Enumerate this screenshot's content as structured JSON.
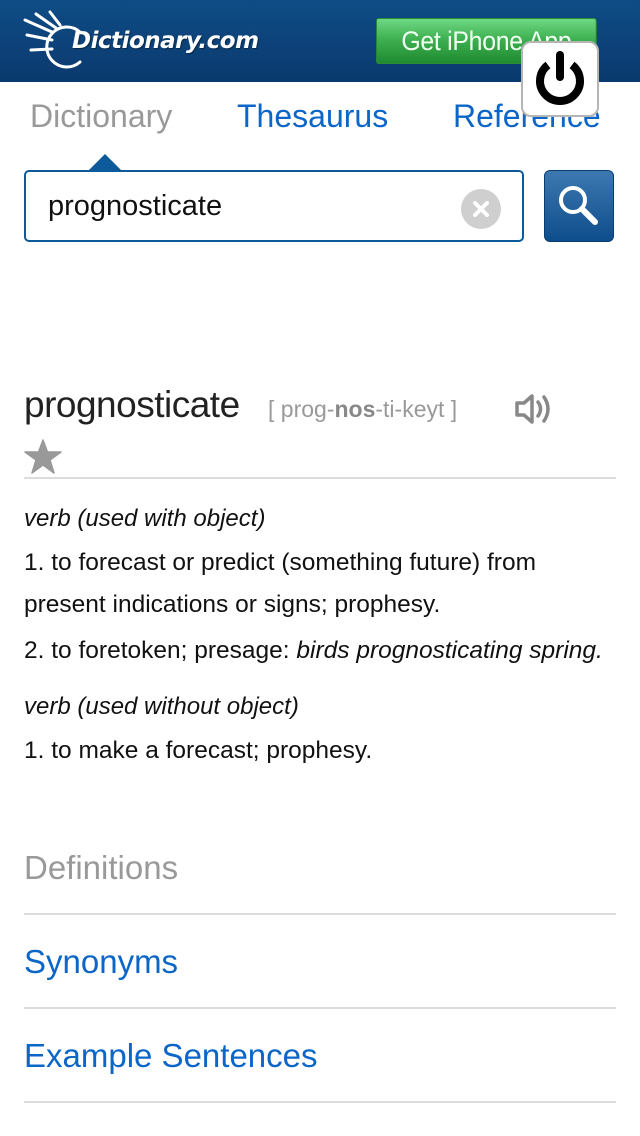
{
  "header": {
    "logo_text": "Dictionary.com",
    "get_app_label": "Get iPhone App",
    "brand_color": "#0f4c86",
    "app_button_color": "#3fb152"
  },
  "overlay": {
    "icon": "power-icon"
  },
  "tabs": [
    {
      "label": "Dictionary",
      "active": true
    },
    {
      "label": "Thesaurus",
      "active": false
    },
    {
      "label": "Reference",
      "active": false
    }
  ],
  "search": {
    "value": "prognosticate",
    "placeholder": "",
    "clear_icon": "clear-icon",
    "button_icon": "search-icon"
  },
  "entry": {
    "headword": "prognosticate",
    "pronunciation": {
      "open": "[ prog-",
      "stressed": "nos",
      "close": "-ti-keyt ]"
    },
    "audio_icon": "speaker-icon",
    "favorite_icon": "star-icon",
    "senses": [
      {
        "pos": "verb (used with object)",
        "definitions": [
          {
            "text": "1. to forecast or predict (something future) from present indications or signs; prophesy.",
            "example": ""
          },
          {
            "text": "2. to foretoken; presage: ",
            "example": "birds prognosticating spring."
          }
        ]
      },
      {
        "pos": "verb (used without object)",
        "definitions": [
          {
            "text": "1. to make a forecast; prophesy.",
            "example": ""
          }
        ]
      }
    ]
  },
  "sections": [
    {
      "label": "Definitions",
      "current": true
    },
    {
      "label": "Synonyms",
      "current": false
    },
    {
      "label": "Example Sentences",
      "current": false
    }
  ],
  "colors": {
    "link": "#0b66c8",
    "muted": "#999999",
    "divider": "#dcdcdc"
  }
}
